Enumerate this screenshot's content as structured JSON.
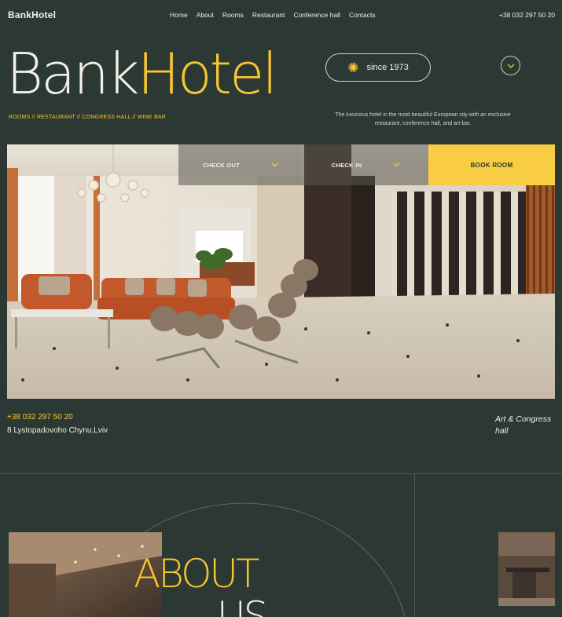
{
  "nav": {
    "logo": "BankHotel",
    "links": [
      "Home",
      "About",
      "Rooms",
      "Restaurant",
      "Conference hall",
      "Contacts"
    ],
    "phone": "+38 032 297 50 20"
  },
  "hero": {
    "title_part1": "Bank",
    "title_part2": "Hotel",
    "since": "since 1973",
    "tagline_left": "ROOMS // RESTAURANT // CONGRESS HALL // WINE BAR",
    "tagline_right": "The luxurious hotel in the most beautiful European city with an exclusive restaurant, conference hall, and art-bar."
  },
  "booking": {
    "check_out": "CHECK OUT",
    "check_in": "CHECK IN",
    "book": "BOOK ROOM"
  },
  "contact": {
    "phone": "+38 032 297 50 20",
    "address": "8 Lystopadovoho Chynu,Lviv",
    "venue": "Art & Congress hall"
  },
  "about": {
    "title_line1": "ABOUT",
    "title_line2": "US"
  },
  "icons": {
    "sun": "sun-icon",
    "chevron": "chevron-down-icon"
  },
  "colors": {
    "background": "#2b3833",
    "accent": "#f6c534",
    "book_button": "#f8cd44"
  }
}
